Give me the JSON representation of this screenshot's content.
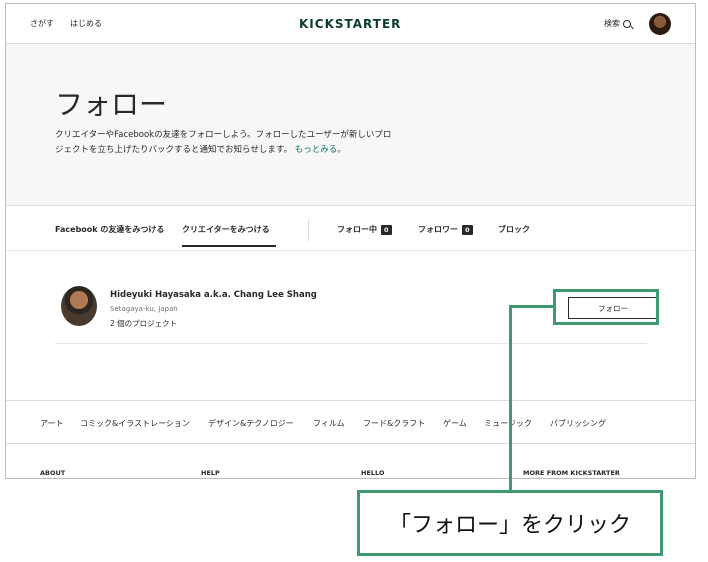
{
  "nav": {
    "discover": "さがす",
    "start": "はじめる",
    "logo": "KICKSTARTER",
    "search": "検索"
  },
  "hero": {
    "title": "フォロー",
    "description": "クリエイターやFacebookの友達をフォローしよう。フォローしたユーザーが新しいプロジェクトを立ち上げたりバックすると通知でお知らせします。",
    "more_link": "もっとみる。"
  },
  "tabs": {
    "facebook": "Facebook の友達をみつける",
    "creators": "クリエイターをみつける",
    "following": "フォロー中",
    "following_count": "0",
    "followers": "フォロワー",
    "followers_count": "0",
    "blocked": "ブロック"
  },
  "creator": {
    "name": "Hideyuki Hayasaka a.k.a. Chang Lee Shang",
    "location": "Setagaya-ku, Japan",
    "projects": "2 個のプロジェクト",
    "follow_button": "フォロー"
  },
  "categories": [
    "アート",
    "コミック&イラストレーション",
    "デザイン&テクノロジー",
    "フィルム",
    "フード&クラフト",
    "ゲーム",
    "ミュージック",
    "パブリッシング"
  ],
  "footer": {
    "about": "ABOUT",
    "help": "HELP",
    "hello": "HELLO",
    "more": "MORE FROM KICKSTARTER"
  },
  "annotation": {
    "text": "「フォロー」をクリック",
    "color": "#3e9a71"
  }
}
